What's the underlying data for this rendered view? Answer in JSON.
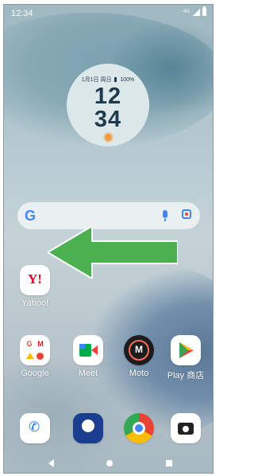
{
  "status_bar": {
    "time": "12:34",
    "network": "4G"
  },
  "clock_widget": {
    "date": "1月1日 周日",
    "battery": "100%",
    "hours": "12",
    "minutes": "34"
  },
  "search_bar": {
    "logo": "G"
  },
  "gesture_hint": {
    "arrow_color": "#4caf50"
  },
  "apps": {
    "yahoo": {
      "label": "Yahoo!"
    },
    "google": {
      "label": "Google"
    },
    "meet": {
      "label": "Meet"
    },
    "moto": {
      "label": "Moto"
    },
    "play": {
      "label": "Play 商店"
    }
  },
  "dock": {
    "icons": [
      "phone-icon",
      "softbank-icon",
      "chrome-icon",
      "camera-icon"
    ]
  },
  "nav": {
    "icons": [
      "back-icon",
      "home-icon",
      "recents-icon"
    ]
  }
}
